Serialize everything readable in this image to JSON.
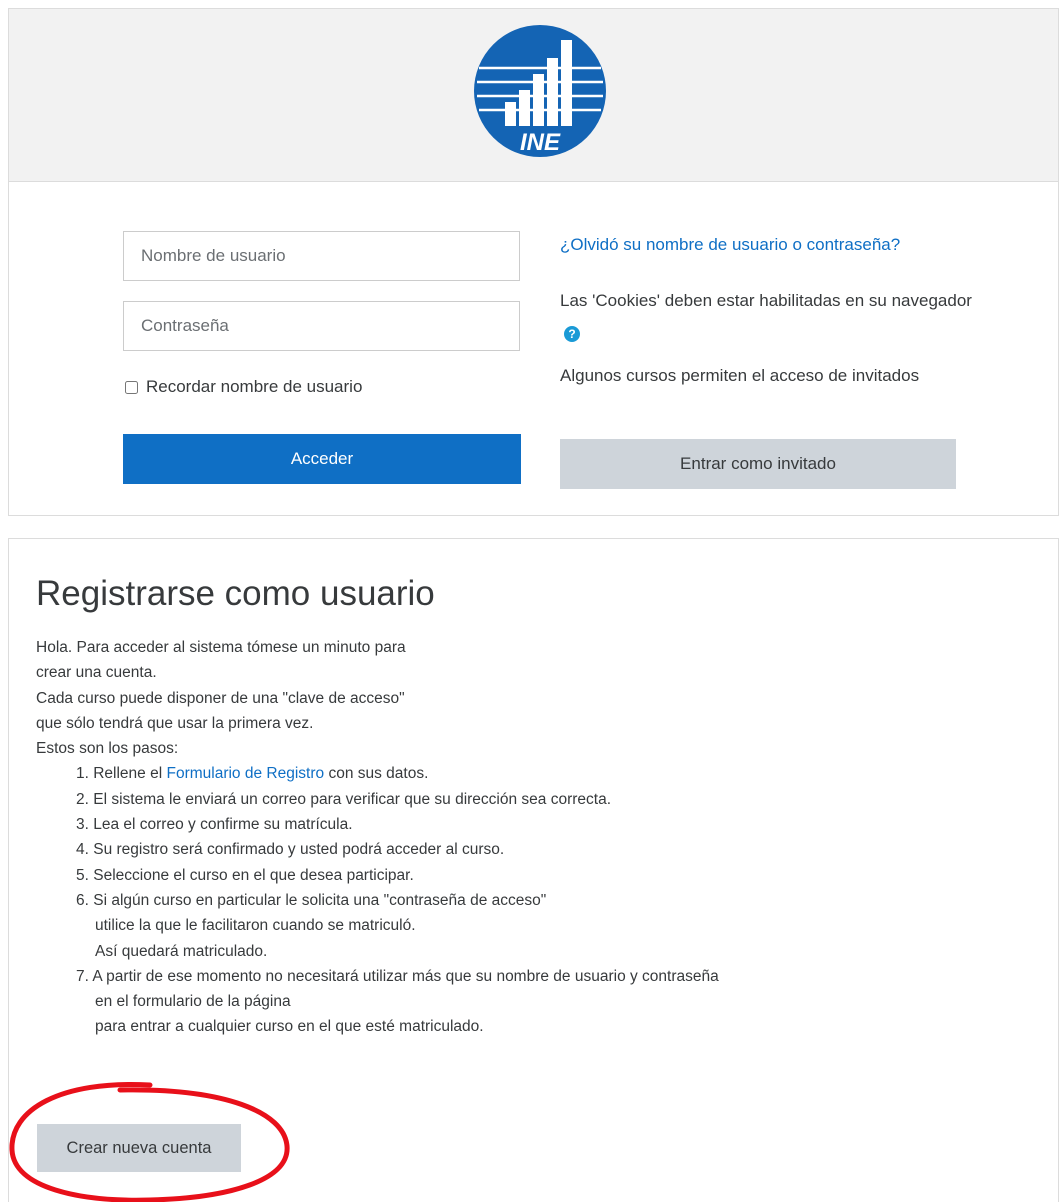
{
  "login": {
    "logo_text": "INE",
    "username_placeholder": "Nombre de usuario",
    "password_placeholder": "Contraseña",
    "remember_label": "Recordar nombre de usuario",
    "login_button": "Acceder",
    "forgot_link": "¿Olvidó su nombre de usuario o contraseña?",
    "cookies_text": "Las 'Cookies' deben estar habilitadas en su navegador",
    "guest_info": "Algunos cursos permiten el acceso de invitados",
    "guest_button": "Entrar como invitado"
  },
  "signup": {
    "title": "Registrarse como usuario",
    "intro": [
      "Hola. Para acceder al sistema tómese un minuto para",
      "crear una cuenta.",
      "Cada curso puede disponer de una \"clave de acceso\"",
      "que sólo tendrá que usar la primera vez.",
      "Estos son los pasos:"
    ],
    "step1_prefix": "1. Rellene el ",
    "step1_link": "Formulario de Registro",
    "step1_suffix": " con sus datos.",
    "step2": "2. El sistema le enviará un correo para verificar que su dirección sea correcta.",
    "step3": "3. Lea el correo y confirme su matrícula.",
    "step4": "4. Su registro será confirmado y usted podrá acceder al curso.",
    "step5": "5. Seleccione el curso en el que desea participar.",
    "step6": [
      "6. Si algún curso en particular le solicita una \"contraseña de acceso\"",
      "utilice la que le facilitaron cuando se matriculó.",
      "Así quedará matriculado."
    ],
    "step7": [
      "7. A partir de ese momento no necesitará utilizar más que su nombre de usuario y contraseña",
      "en el formulario de la página",
      "para entrar a cualquier curso en el que esté matriculado."
    ],
    "create_button": "Crear nueva cuenta"
  },
  "colors": {
    "primary": "#0f6fc5",
    "secondary_button": "#ced4da",
    "header_bg": "#f2f2f2",
    "logo_blue": "#1464b4",
    "annotation_red": "#e8101a"
  }
}
